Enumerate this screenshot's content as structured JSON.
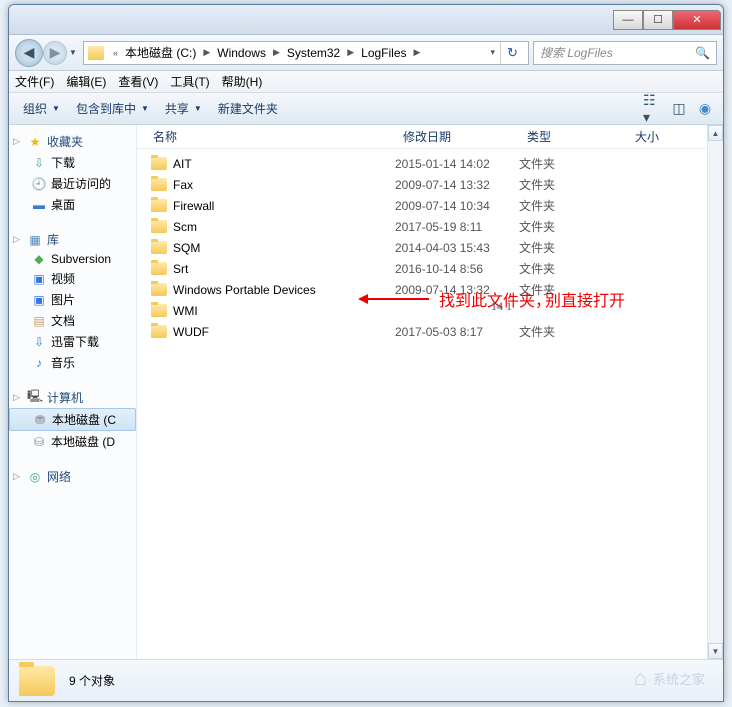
{
  "titlebar": {
    "min": "—",
    "max": "☐",
    "close": "✕"
  },
  "nav": {
    "back": "◀",
    "fwd": "▶",
    "drop": "▼",
    "crumbs": [
      "本地磁盘 (C:)",
      "Windows",
      "System32",
      "LogFiles"
    ],
    "refresh": "↻",
    "search_placeholder": "搜索 LogFiles",
    "search_icon": "🔍"
  },
  "menu": {
    "file": "文件(F)",
    "edit": "编辑(E)",
    "view": "查看(V)",
    "tools": "工具(T)",
    "help": "帮助(H)"
  },
  "toolbar": {
    "organize": "组织",
    "include": "包含到库中",
    "share": "共享",
    "newfolder": "新建文件夹",
    "drop": "▼"
  },
  "columns": {
    "name": "名称",
    "date": "修改日期",
    "type": "类型",
    "size": "大小"
  },
  "sidebar": {
    "fav": {
      "label": "收藏夹",
      "items": [
        {
          "icon": "⇩",
          "cls": "ico-dl",
          "label": "下载"
        },
        {
          "icon": "🕘",
          "cls": "ico-recent",
          "label": "最近访问的"
        },
        {
          "icon": "▬",
          "cls": "ico-desktop",
          "label": "桌面"
        }
      ]
    },
    "lib": {
      "label": "库",
      "items": [
        {
          "icon": "◆",
          "cls": "ico-svn",
          "label": "Subversion"
        },
        {
          "icon": "▣",
          "cls": "ico-video",
          "label": "视频"
        },
        {
          "icon": "▣",
          "cls": "ico-pic",
          "label": "图片"
        },
        {
          "icon": "▤",
          "cls": "ico-doc",
          "label": "文档"
        },
        {
          "icon": "⇩",
          "cls": "ico-xunlei",
          "label": "迅雷下载"
        },
        {
          "icon": "♪",
          "cls": "ico-music",
          "label": "音乐"
        }
      ]
    },
    "computer": {
      "label": "计算机",
      "items": [
        {
          "icon": "⛃",
          "cls": "ico-drive",
          "label": "本地磁盘 (C",
          "selected": true
        },
        {
          "icon": "⛁",
          "cls": "ico-drive",
          "label": "本地磁盘 (D"
        }
      ]
    },
    "network": {
      "label": "网络"
    }
  },
  "files": [
    {
      "name": "AIT",
      "date": "2015-01-14 14:02",
      "type": "文件夹"
    },
    {
      "name": "Fax",
      "date": "2009-07-14 13:32",
      "type": "文件夹"
    },
    {
      "name": "Firewall",
      "date": "2009-07-14 10:34",
      "type": "文件夹"
    },
    {
      "name": "Scm",
      "date": "2017-05-19 8:11",
      "type": "文件夹"
    },
    {
      "name": "SQM",
      "date": "2014-04-03 15:43",
      "type": "文件夹"
    },
    {
      "name": "Srt",
      "date": "2016-10-14 8:56",
      "type": "文件夹"
    },
    {
      "name": "Windows Portable Devices",
      "date": "2009-07-14 13:32",
      "type": "文件夹"
    },
    {
      "name": "WMI",
      "date": "",
      "type": ""
    },
    {
      "name": "WUDF",
      "date": "2017-05-03 8:17",
      "type": "文件夹"
    }
  ],
  "annotation": {
    "text1": "找到此文件夹，",
    "text2": "别直接打开",
    "wmi_date_partial": "14 1"
  },
  "status": {
    "count": "9 个对象"
  },
  "watermark": {
    "text": "系统之家"
  }
}
